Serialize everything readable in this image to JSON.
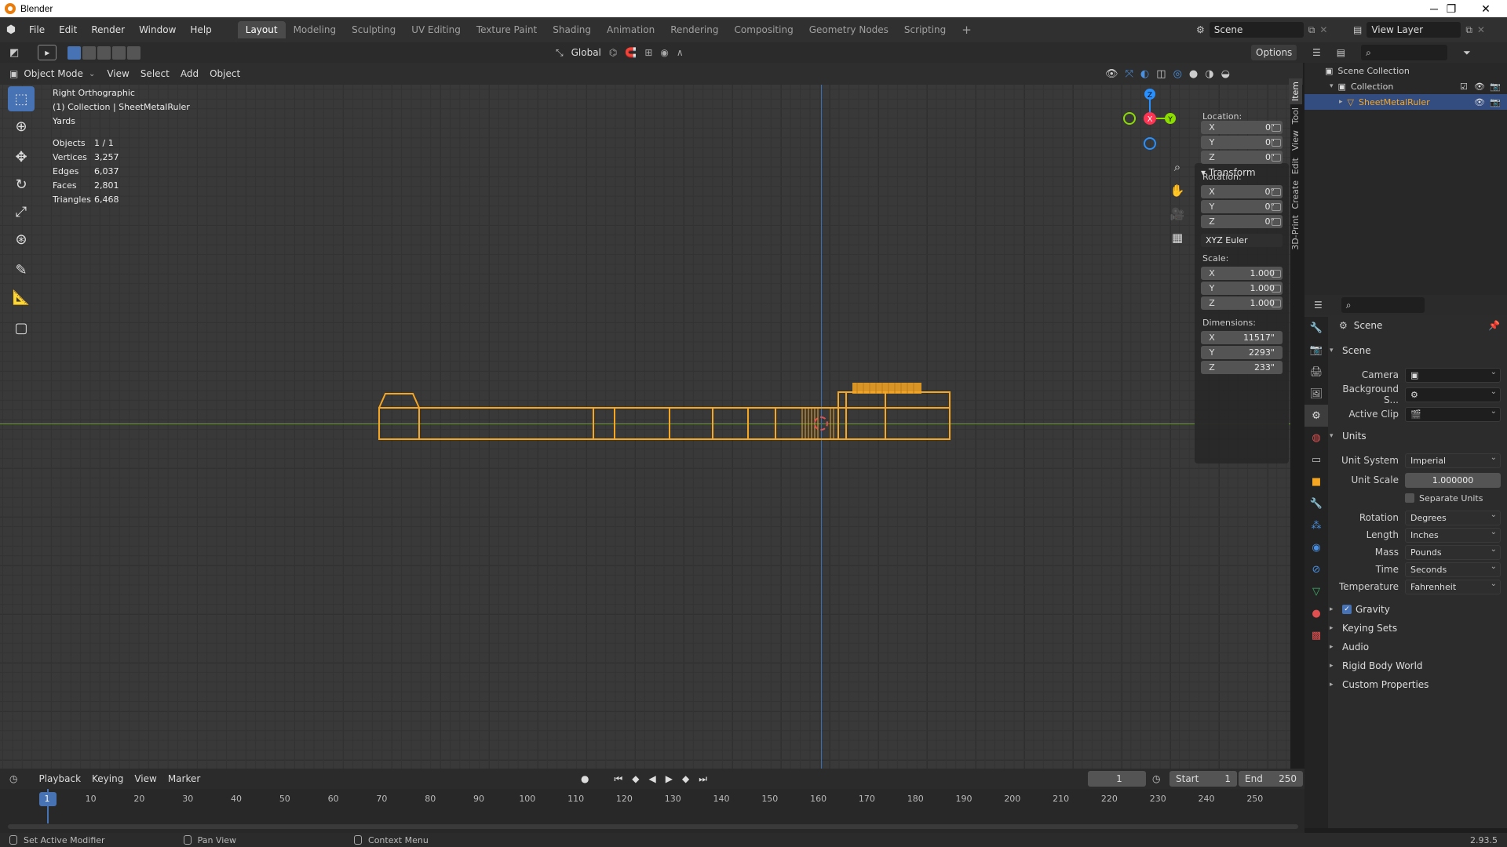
{
  "window": {
    "title": "Blender",
    "min": "─",
    "max": "❐",
    "close": "✕"
  },
  "menu": {
    "items": [
      "File",
      "Edit",
      "Render",
      "Window",
      "Help"
    ]
  },
  "workspaces": [
    "Layout",
    "Modeling",
    "Sculpting",
    "UV Editing",
    "Texture Paint",
    "Shading",
    "Animation",
    "Rendering",
    "Compositing",
    "Geometry Nodes",
    "Scripting"
  ],
  "active_workspace": "Layout",
  "scene_name": "Scene",
  "view_layer": "View Layer",
  "tool_header": {
    "orientation": "Global",
    "options": "Options"
  },
  "viewport_header": {
    "mode": "Object Mode",
    "menus": [
      "View",
      "Select",
      "Add",
      "Object"
    ]
  },
  "overlay": {
    "view_name": "Right Orthographic",
    "collection": "(1) Collection | SheetMetalRuler",
    "units": "Yards",
    "stats": [
      {
        "k": "Objects",
        "v": "1 / 1"
      },
      {
        "k": "Vertices",
        "v": "3,257"
      },
      {
        "k": "Edges",
        "v": "6,037"
      },
      {
        "k": "Faces",
        "v": "2,801"
      },
      {
        "k": "Triangles",
        "v": "6,468"
      }
    ]
  },
  "gizmo": {
    "z": "Z",
    "y": "Y",
    "x": "X"
  },
  "npanel": {
    "header": "Transform",
    "location_label": "Location:",
    "location": [
      "0\"",
      "0\"",
      "0\""
    ],
    "rotation_label": "Rotation:",
    "rotation": [
      "0°",
      "0°",
      "0°"
    ],
    "rotation_mode": "XYZ Euler",
    "scale_label": "Scale:",
    "scale": [
      "1.000",
      "1.000",
      "1.000"
    ],
    "dimensions_label": "Dimensions:",
    "dimensions": [
      "11517\"",
      "2293\"",
      "233\""
    ],
    "axes": [
      "X",
      "Y",
      "Z"
    ]
  },
  "side_tabs": [
    "Item",
    "Tool",
    "View",
    "Edit",
    "Create",
    "3D-Print"
  ],
  "outliner": {
    "root": "Scene Collection",
    "collection": "Collection",
    "object": "SheetMetalRuler"
  },
  "properties": {
    "context": "Scene",
    "scene_section": "Scene",
    "camera_label": "Camera",
    "background_label": "Background S...",
    "clip_label": "Active Clip",
    "units_section": "Units",
    "unit_system_label": "Unit System",
    "unit_system": "Imperial",
    "unit_scale_label": "Unit Scale",
    "unit_scale": "1.000000",
    "separate_units": "Separate Units",
    "rotation_label": "Rotation",
    "rotation": "Degrees",
    "length_label": "Length",
    "length": "Inches",
    "mass_label": "Mass",
    "mass": "Pounds",
    "time_label": "Time",
    "time": "Seconds",
    "temperature_label": "Temperature",
    "temperature": "Fahrenheit",
    "collapsed": [
      "Gravity",
      "Keying Sets",
      "Audio",
      "Rigid Body World",
      "Custom Properties"
    ]
  },
  "timeline": {
    "menus": [
      "Playback",
      "Keying",
      "View",
      "Marker"
    ],
    "current_frame": "1",
    "start_label": "Start",
    "start": "1",
    "end_label": "End",
    "end": "250",
    "ticks": [
      "1",
      "10",
      "20",
      "30",
      "40",
      "50",
      "60",
      "70",
      "80",
      "90",
      "100",
      "110",
      "120",
      "130",
      "140",
      "150",
      "160",
      "170",
      "180",
      "190",
      "200",
      "210",
      "220",
      "230",
      "240",
      "250"
    ]
  },
  "status": {
    "left": "Set Active Modifier",
    "mid": "Pan View",
    "right": "Context Menu",
    "version": "2.93.5"
  },
  "colors": {
    "accent": "#4772b3",
    "selection": "#f5a623",
    "x_axis": "#ff3352",
    "y_axis": "#8bdc00",
    "z_axis": "#2890ff"
  }
}
